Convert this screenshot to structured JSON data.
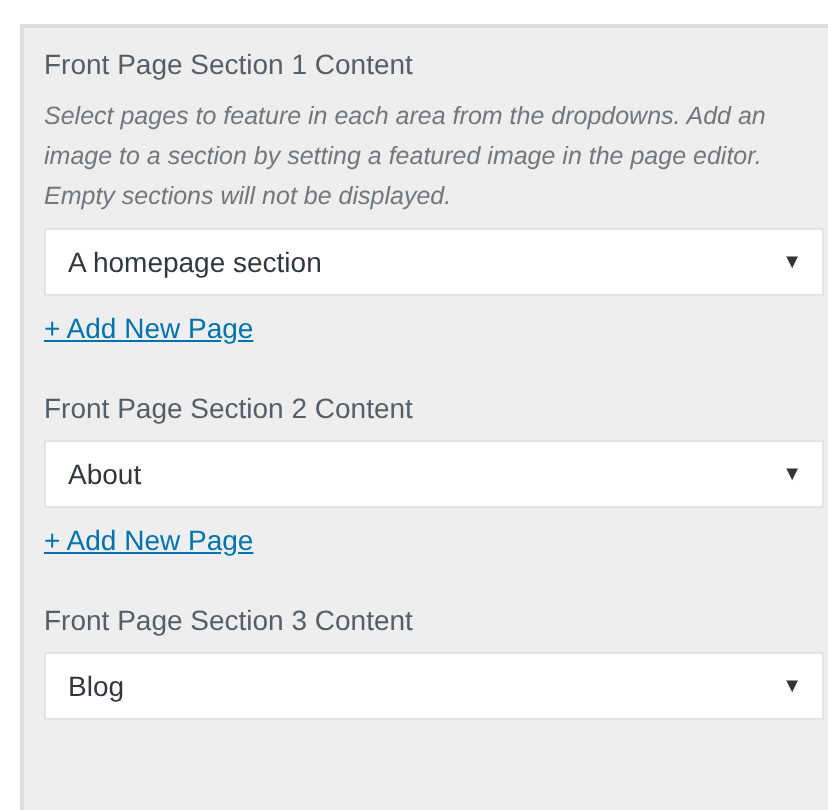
{
  "sections": [
    {
      "title": "Front Page Section 1 Content",
      "description": "Select pages to feature in each area from the dropdowns. Add an image to a section by setting a featured image in the page editor. Empty sections will not be displayed.",
      "select": {
        "value": "A homepage section",
        "arrow": "▼"
      },
      "link": "+ Add New Page"
    },
    {
      "title": "Front Page Section 2 Content",
      "select": {
        "value": "About",
        "arrow": "▼"
      },
      "link": "+ Add New Page"
    },
    {
      "title": "Front Page Section 3 Content",
      "select": {
        "value": "Blog",
        "arrow": "▼"
      }
    }
  ]
}
